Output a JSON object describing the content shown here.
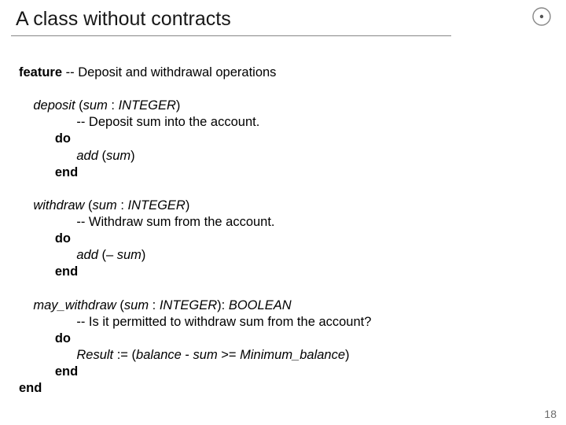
{
  "title": "A class without contracts",
  "pagenum": "18",
  "logo_name": "circle-dot-icon",
  "l1a": "feature",
  "l1b": " -- Deposit and withdrawal operations",
  "l2a": "deposit ",
  "l2b": "(",
  "l2c": "sum ",
  "l2d": ": ",
  "l2e": "INTEGER",
  "l2f": ")",
  "l3a": "-- Deposit ",
  "l3b": "sum",
  "l3c": " into the account.",
  "l4": "do",
  "l5a": "add ",
  "l5b": "(",
  "l5c": "sum",
  "l5d": ")",
  "l6": "end",
  "l7a": "withdraw ",
  "l7b": "(",
  "l7c": "sum ",
  "l7d": ": ",
  "l7e": "INTEGER",
  "l7f": ")",
  "l8a": "-- Withdraw ",
  "l8b": "sum",
  "l8c": " from the account.",
  "l9": "do",
  "l10a": "add ",
  "l10b": "(– ",
  "l10c": "sum",
  "l10d": ")",
  "l11": "end",
  "l12a": "may_withdraw ",
  "l12b": "(",
  "l12c": "sum ",
  "l12d": ": ",
  "l12e": "INTEGER",
  "l12f": "): ",
  "l12g": "BOOLEAN",
  "l13a": "-- Is it permitted to withdraw ",
  "l13b": "sum",
  "l13c": " from the account?",
  "l14": "do",
  "l15a": "Result ",
  "l15b": ":= (",
  "l15c": "balance ",
  "l15d": "- ",
  "l15e": "sum ",
  "l15f": ">= ",
  "l15g": "Minimum_balance",
  "l15h": ")",
  "l16": "end",
  "l17": "end"
}
